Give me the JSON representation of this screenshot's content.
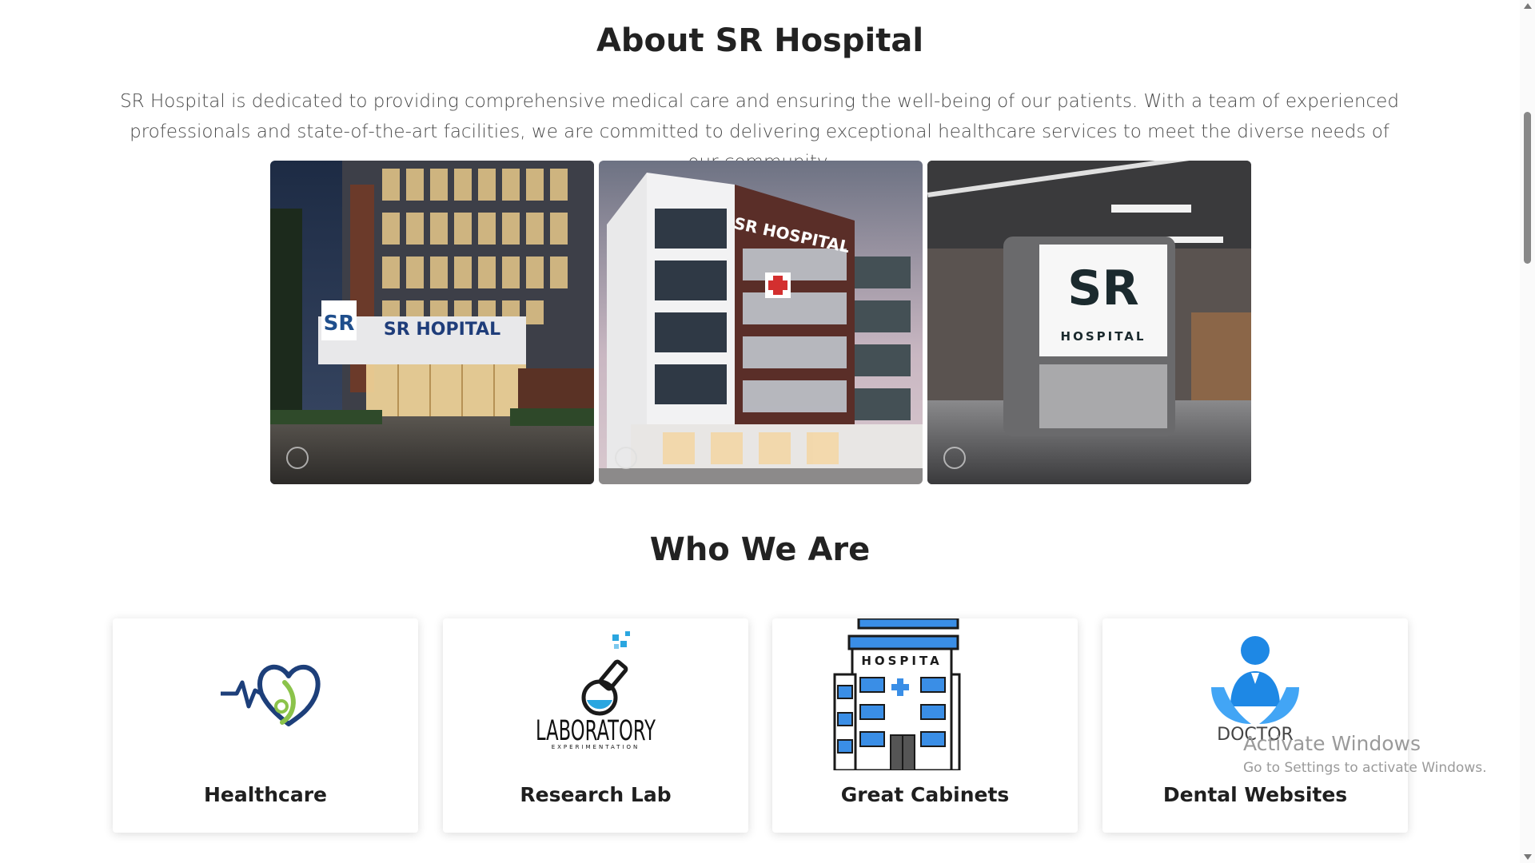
{
  "about": {
    "title": "About SR Hospital",
    "text": "SR Hospital is dedicated to providing comprehensive medical care and ensuring the well-being of our patients. With a team of experienced professionals and state-of-the-art facilities, we are committed to delivering exceptional healthcare services to meet the diverse needs of our community."
  },
  "gallery": {
    "photo1": {
      "sign_text": "SR HOPITAL",
      "logo_text": "SR"
    },
    "photo2": {
      "sign_text": "SR HOSPITAL"
    },
    "photo3": {
      "logo_text": "SR",
      "logo_sub": "HOSPITAL"
    }
  },
  "who": {
    "title": "Who We Are",
    "cards": [
      {
        "label": "Healthcare",
        "icon": "heart-pulse-stethoscope-icon"
      },
      {
        "label": "Research Lab",
        "icon": "laboratory-flask-icon",
        "logo_text": "LABORATORY",
        "logo_sub": "EXPERIMENTATION"
      },
      {
        "label": "Great Cabinets",
        "icon": "hospital-building-icon",
        "logo_text": "HOSPITA"
      },
      {
        "label": "Dental Websites",
        "icon": "doctor-hands-icon",
        "logo_text": "DOCTOR"
      }
    ]
  },
  "watermark": {
    "title": "Activate Windows",
    "subtitle": "Go to Settings to activate Windows."
  },
  "colors": {
    "heading": "#222222",
    "body_text": "#4a4a4a",
    "healthcare_blue": "#1d3f7a",
    "healthcare_green": "#8bc34a",
    "lab_blue": "#2aa6e0",
    "hospital_blue": "#3a8ee6",
    "doctor_blue": "#1e88e5"
  }
}
